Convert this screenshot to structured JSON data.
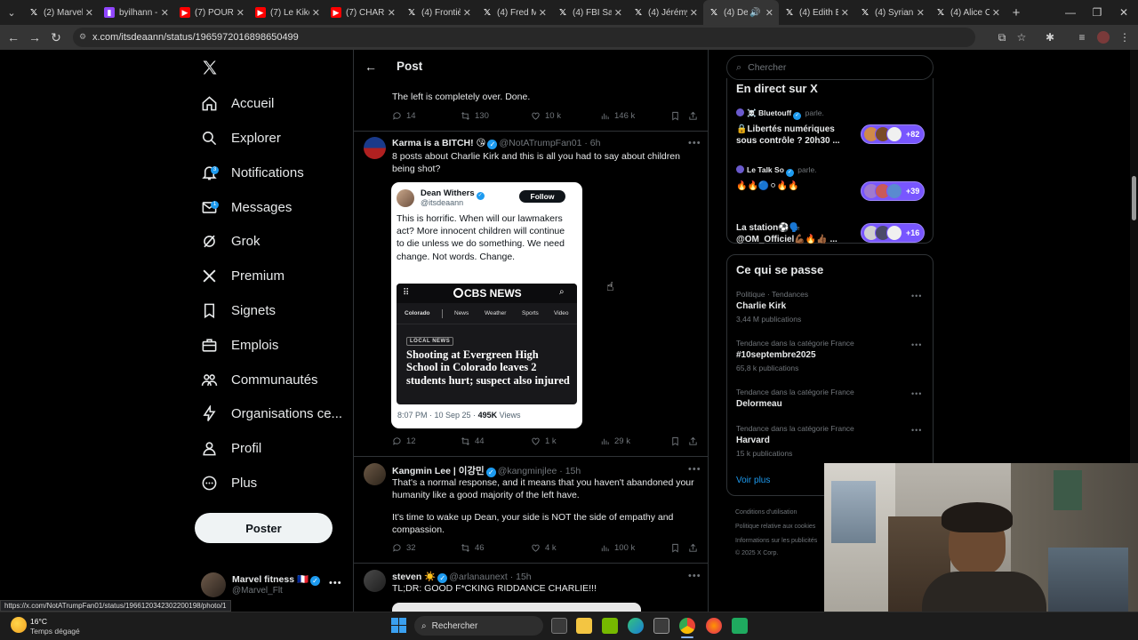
{
  "browser": {
    "tabs": [
      {
        "label": "(2) Marvel",
        "fav": "x",
        "color": "#ffffff"
      },
      {
        "label": "byilhann -",
        "fav": "twitch",
        "color": "#9146ff"
      },
      {
        "label": "(7) POURQ",
        "fav": "yt",
        "color": "#ff0000"
      },
      {
        "label": "(7) Le Kiko",
        "fav": "yt",
        "color": "#ff0000"
      },
      {
        "label": "(7) CHARLI",
        "fav": "yt",
        "color": "#ff0000"
      },
      {
        "label": "(4) Frontiè",
        "fav": "x",
        "color": "#ffffff"
      },
      {
        "label": "(4) Fred M",
        "fav": "x",
        "color": "#ffffff"
      },
      {
        "label": "(4) FBI Salt",
        "fav": "x",
        "color": "#ffffff"
      },
      {
        "label": "(4) Jérémy",
        "fav": "x",
        "color": "#ffffff"
      },
      {
        "label": "(4) De",
        "fav": "x",
        "color": "#ffffff",
        "active": true
      },
      {
        "label": "(4) Edith B",
        "fav": "x",
        "color": "#ffffff"
      },
      {
        "label": "(4) Syrian",
        "fav": "x",
        "color": "#ffffff"
      },
      {
        "label": "(4) Alice C",
        "fav": "x",
        "color": "#ffffff"
      }
    ],
    "url": "x.com/itsdeaann/status/1965972016898650499",
    "status_url": "https://x.com/NotATrumpFan01/status/1966120342302200198/photo/1"
  },
  "sidebar": {
    "items": [
      {
        "label": "Accueil",
        "icon": "home-icon"
      },
      {
        "label": "Explorer",
        "icon": "search-icon"
      },
      {
        "label": "Notifications",
        "icon": "bell-icon",
        "badge": "3"
      },
      {
        "label": "Messages",
        "icon": "mail-icon",
        "badge": "1"
      },
      {
        "label": "Grok",
        "icon": "grok-icon"
      },
      {
        "label": "Premium",
        "icon": "x-logo-icon"
      },
      {
        "label": "Signets",
        "icon": "bookmark-icon"
      },
      {
        "label": "Emplois",
        "icon": "briefcase-icon"
      },
      {
        "label": "Communautés",
        "icon": "people-icon"
      },
      {
        "label": "Organisations ce...",
        "icon": "lightning-icon"
      },
      {
        "label": "Profil",
        "icon": "person-icon"
      },
      {
        "label": "Plus",
        "icon": "more-circle-icon"
      }
    ],
    "post_button": "Poster",
    "account": {
      "name": "Marvel fitness 🇫🇷",
      "handle": "@Marvel_Flt"
    }
  },
  "center": {
    "header_title": "Post",
    "top_tweet": {
      "text": "The left is completely over. Done.",
      "replies": "14",
      "retweets": "130",
      "likes": "10 k",
      "views": "146 k"
    },
    "tweets": [
      {
        "name": "Karma is a BITCH! 😘",
        "handle": "@NotATrumpFan01 · 6h",
        "text": "8 posts about Charlie Kirk and this is all you had to say about children being shot?",
        "replies": "12",
        "retweets": "44",
        "likes": "1 k",
        "views": "29 k",
        "quote": {
          "name": "Dean Withers",
          "handle": "@itsdeaann",
          "follow": "Follow",
          "text": "This is horrific. When will our lawmakers act? More innocent children will continue to die unless we do something. We need change. Not words. Change.",
          "cbs_logo": "CBS NEWS",
          "cbs_nav": [
            "Colorado",
            "News",
            "Weather",
            "Sports",
            "Video"
          ],
          "cbs_tag": "LOCAL NEWS",
          "cbs_headline": "Shooting at Evergreen High School in Colorado leaves 2 students hurt; suspect also injured",
          "meta_time": "8:07 PM · 10 Sep 25 ·",
          "meta_views": "495K",
          "meta_views_label": "Views"
        }
      },
      {
        "name": "Kangmin Lee | 이강민",
        "handle": "@kangminjlee · 15h",
        "text1": "That's a normal response, and it means that you haven't abandoned your humanity like a good majority of the left have.",
        "text2": "It's time to wake up Dean, your side is NOT the side of empathy and compassion.",
        "replies": "32",
        "retweets": "46",
        "likes": "4 k",
        "views": "100 k"
      },
      {
        "name": "steven ☀️",
        "handle": "@arlanaunext · 15h",
        "text": "TL;DR: GOOD F*CKING RIDDANCE CHARLIE!!!"
      }
    ]
  },
  "right": {
    "search_placeholder": "Chercher",
    "live_title": "En direct sur X",
    "spaces": [
      {
        "host": "☠️ Bluetouff",
        "host_suffix": "parle.",
        "title": "🔒Libertés numériques sous contrôle ? 20h30 ...",
        "count": "+82"
      },
      {
        "host": "Le Talk So",
        "host_suffix": "parle.",
        "title": "🔥🔥🔵⚪🔥🔥",
        "count": "+39"
      },
      {
        "host": "",
        "host_suffix": "",
        "title": "La station⚽🗣️ @OM_Officiel💪🏾🔥👍🏾 ...",
        "count": "+16"
      }
    ],
    "trends_title": "Ce qui se passe",
    "trends": [
      {
        "meta": "Politique · Tendances",
        "title": "Charlie Kirk",
        "count": "3,44 M publications"
      },
      {
        "meta": "Tendance dans la catégorie France",
        "title": "#10septembre2025",
        "count": "65,8 k publications"
      },
      {
        "meta": "Tendance dans la catégorie France",
        "title": "Delormeau",
        "count": ""
      },
      {
        "meta": "Tendance dans la catégorie France",
        "title": "Harvard",
        "count": "15 k publications"
      }
    ],
    "see_more": "Voir plus",
    "footer": [
      "Conditions d'utilisation",
      "Politique relative aux cookies",
      "Informations sur les publicités",
      "© 2025 X Corp."
    ]
  },
  "taskbar": {
    "weather_temp": "16°C",
    "weather_desc": "Temps dégagé",
    "search": "Rechercher"
  },
  "colors": {
    "accent": "#1d9bf0",
    "space_purple": "#7856ff",
    "border": "#2f3336",
    "muted": "#71767b"
  }
}
